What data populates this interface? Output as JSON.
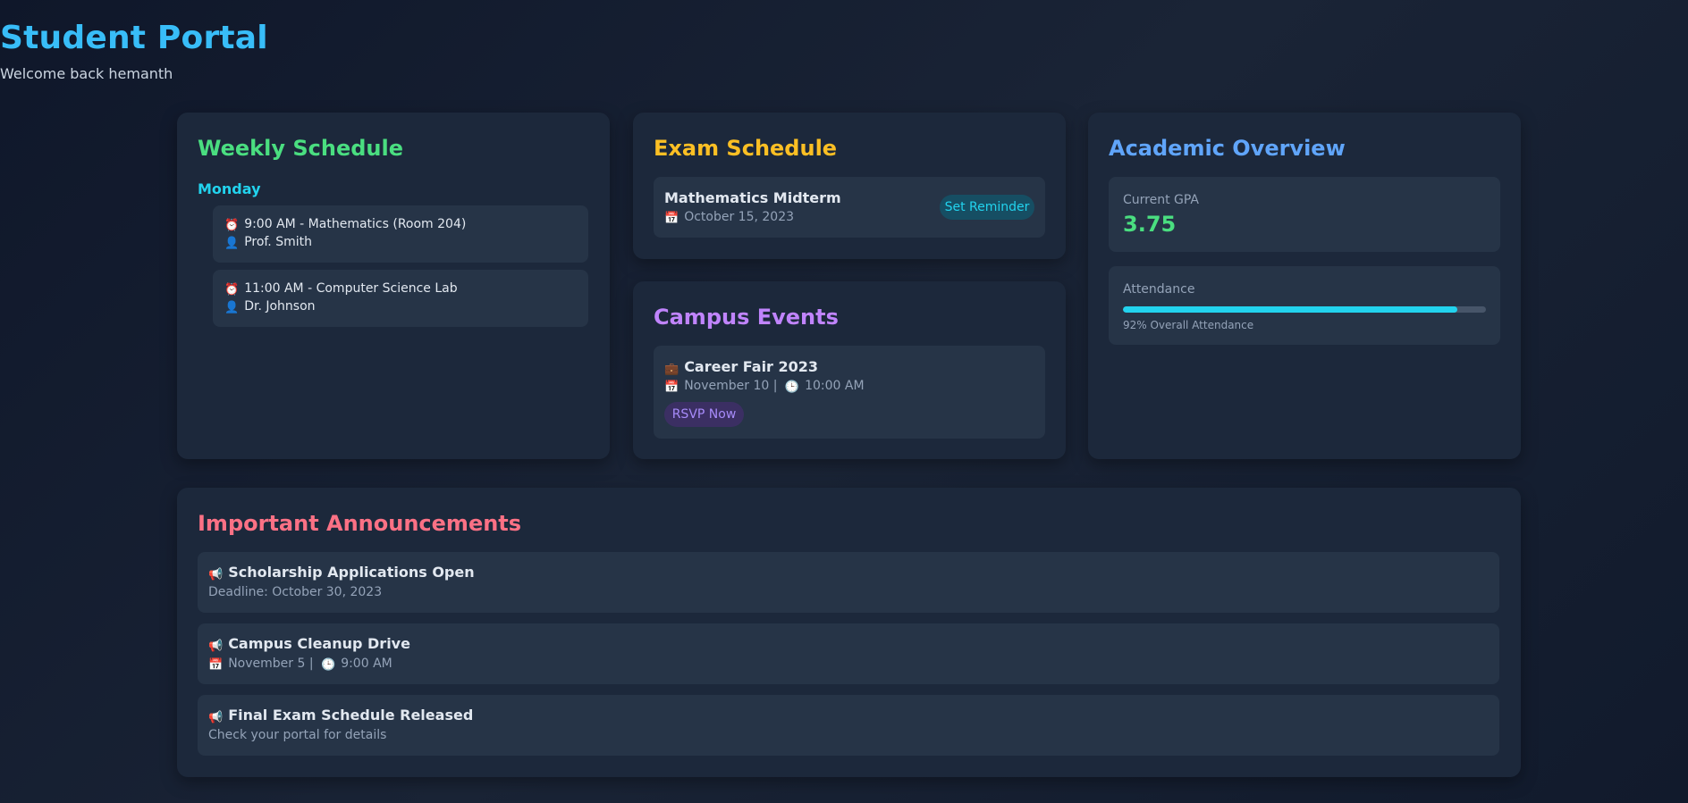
{
  "header": {
    "title": "Student Portal",
    "subtitle": "Welcome back hemanth"
  },
  "colors": {
    "title": "#38bdf8",
    "weekly": "#4ade80",
    "exam": "#fbbf24",
    "academic": "#60a5fa",
    "events": "#c084fc",
    "announcements": "#fb7185",
    "day": "#22d3ee"
  },
  "weekly": {
    "title": "Weekly Schedule",
    "day": "Monday",
    "classes": [
      {
        "icon": "alarm-clock-icon",
        "time_course": "9:00 AM - Mathematics (Room 204)",
        "instructor_icon": "person-icon",
        "instructor": "Prof. Smith"
      },
      {
        "icon": "alarm-clock-icon",
        "time_course": "11:00 AM - Computer Science Lab",
        "instructor_icon": "person-icon",
        "instructor": "Dr. Johnson"
      }
    ]
  },
  "exam": {
    "title": "Exam Schedule",
    "items": [
      {
        "name": "Mathematics Midterm",
        "icon": "calendar-icon",
        "date": "October 15, 2023",
        "button": "Set Reminder"
      }
    ]
  },
  "events": {
    "title": "Campus Events",
    "items": [
      {
        "icon": "briefcase-person-icon",
        "name": "Career Fair 2023",
        "date_icon": "calendar-icon",
        "date": "November 10 |",
        "time_icon": "clock-icon",
        "time": "10:00 AM",
        "button": "RSVP Now"
      }
    ]
  },
  "academic": {
    "title": "Academic Overview",
    "gpa_label": "Current GPA",
    "gpa_value": "3.75",
    "attendance_label": "Attendance",
    "attendance_percent": 92,
    "attendance_text": "92% Overall Attendance"
  },
  "announcements": {
    "title": "Important Announcements",
    "items": [
      {
        "icon": "megaphone-icon",
        "title": "Scholarship Applications Open",
        "detail": "Deadline: October 30, 2023"
      },
      {
        "icon": "megaphone-icon",
        "title": "Campus Cleanup Drive",
        "date_icon": "calendar-icon",
        "date": "November 5 |",
        "time_icon": "clock-icon",
        "time": "9:00 AM"
      },
      {
        "icon": "megaphone-icon",
        "title": "Final Exam Schedule Released",
        "detail": "Check your portal for details"
      }
    ]
  }
}
